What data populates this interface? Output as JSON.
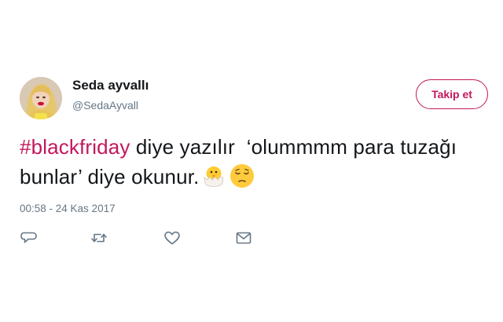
{
  "tweet": {
    "author": {
      "display_name": "Seda ayvallı",
      "handle": "@SedaAyvall"
    },
    "follow_label": "Takip et",
    "text": {
      "hashtag": "#blackfriday",
      "body": " diye yazılır  ‘olummmm para tuzağı bunlar’ diye okunur."
    },
    "emojis": [
      "hatching-chick-emoji",
      "pensive-face-emoji"
    ],
    "timestamp": "00:58 - 24 Kas 2017",
    "actions": [
      "reply-icon",
      "retweet-icon",
      "like-icon",
      "direct-message-icon"
    ]
  },
  "colors": {
    "accent": "#c2185b",
    "text": "#14171a",
    "secondary_text": "#657786",
    "icon": "#657786"
  }
}
